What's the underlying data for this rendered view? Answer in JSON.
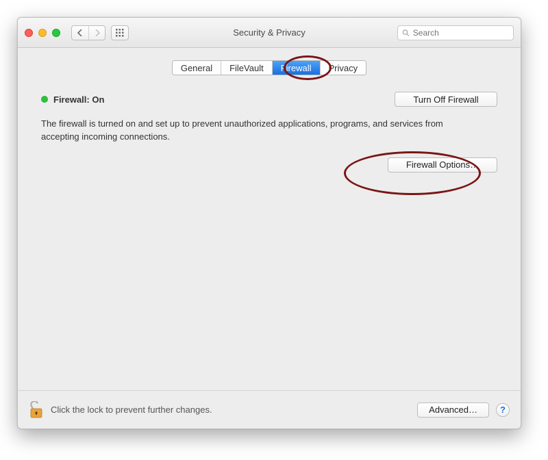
{
  "window": {
    "title": "Security & Privacy"
  },
  "search": {
    "placeholder": "Search"
  },
  "tabs": {
    "general": "General",
    "filevault": "FileVault",
    "firewall": "Firewall",
    "privacy": "Privacy",
    "active": "firewall"
  },
  "status": {
    "label": "Firewall: On",
    "color": "#2ec13c"
  },
  "buttons": {
    "turn_off": "Turn Off Firewall",
    "options": "Firewall Options…",
    "advanced": "Advanced…",
    "help": "?"
  },
  "description": "The firewall is turned on and set up to prevent unauthorized applications, programs, and services from accepting incoming connections.",
  "footer": {
    "lock_text": "Click the lock to prevent further changes."
  }
}
